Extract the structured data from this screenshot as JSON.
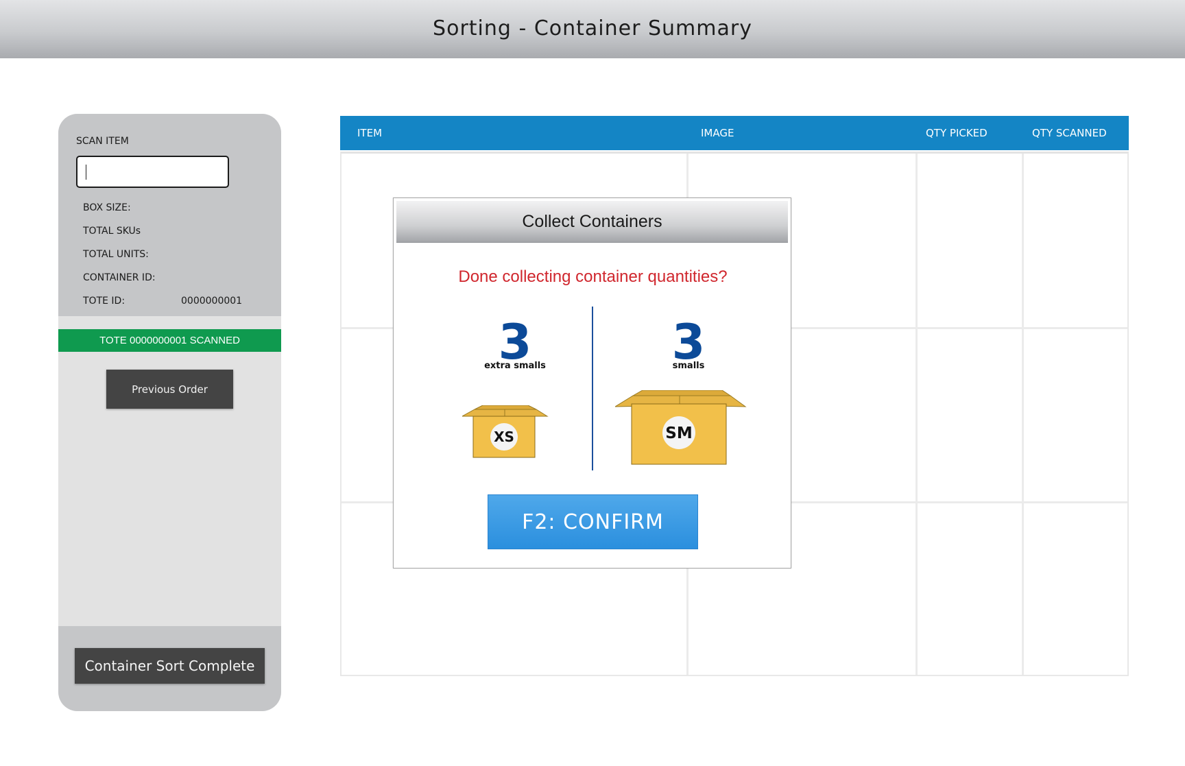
{
  "header": {
    "title": "Sorting - Container Summary"
  },
  "sidebar": {
    "scan_label": "SCAN ITEM",
    "scan_value": "",
    "fields": [
      {
        "label": "BOX SIZE:",
        "value": ""
      },
      {
        "label": "TOTAL SKUs",
        "value": ""
      },
      {
        "label": "TOTAL UNITS:",
        "value": ""
      },
      {
        "label": "CONTAINER ID:",
        "value": ""
      },
      {
        "label": "TOTE ID:",
        "value": "0000000001"
      }
    ],
    "tote_banner": "TOTE 0000000001 SCANNED",
    "previous_order_label": "Previous Order",
    "complete_label": "Container Sort Complete",
    "banner_color": "#0f9a4f"
  },
  "table": {
    "columns": [
      "ITEM",
      "IMAGE",
      "QTY PICKED",
      "QTY SCANNED"
    ],
    "header_color": "#1485c5",
    "rows": [
      [
        "",
        "",
        "",
        ""
      ],
      [
        "",
        "",
        "",
        ""
      ],
      [
        "",
        "",
        "",
        ""
      ]
    ]
  },
  "modal": {
    "title": "Collect Containers",
    "question": "Done collecting container quantities?",
    "question_color": "#d0262d",
    "containers": [
      {
        "qty": "3",
        "label": "extra smalls",
        "size_badge": "XS",
        "icon": "box-icon"
      },
      {
        "qty": "3",
        "label": "smalls",
        "size_badge": "SM",
        "icon": "box-icon"
      }
    ],
    "confirm_label": "F2: CONFIRM"
  }
}
